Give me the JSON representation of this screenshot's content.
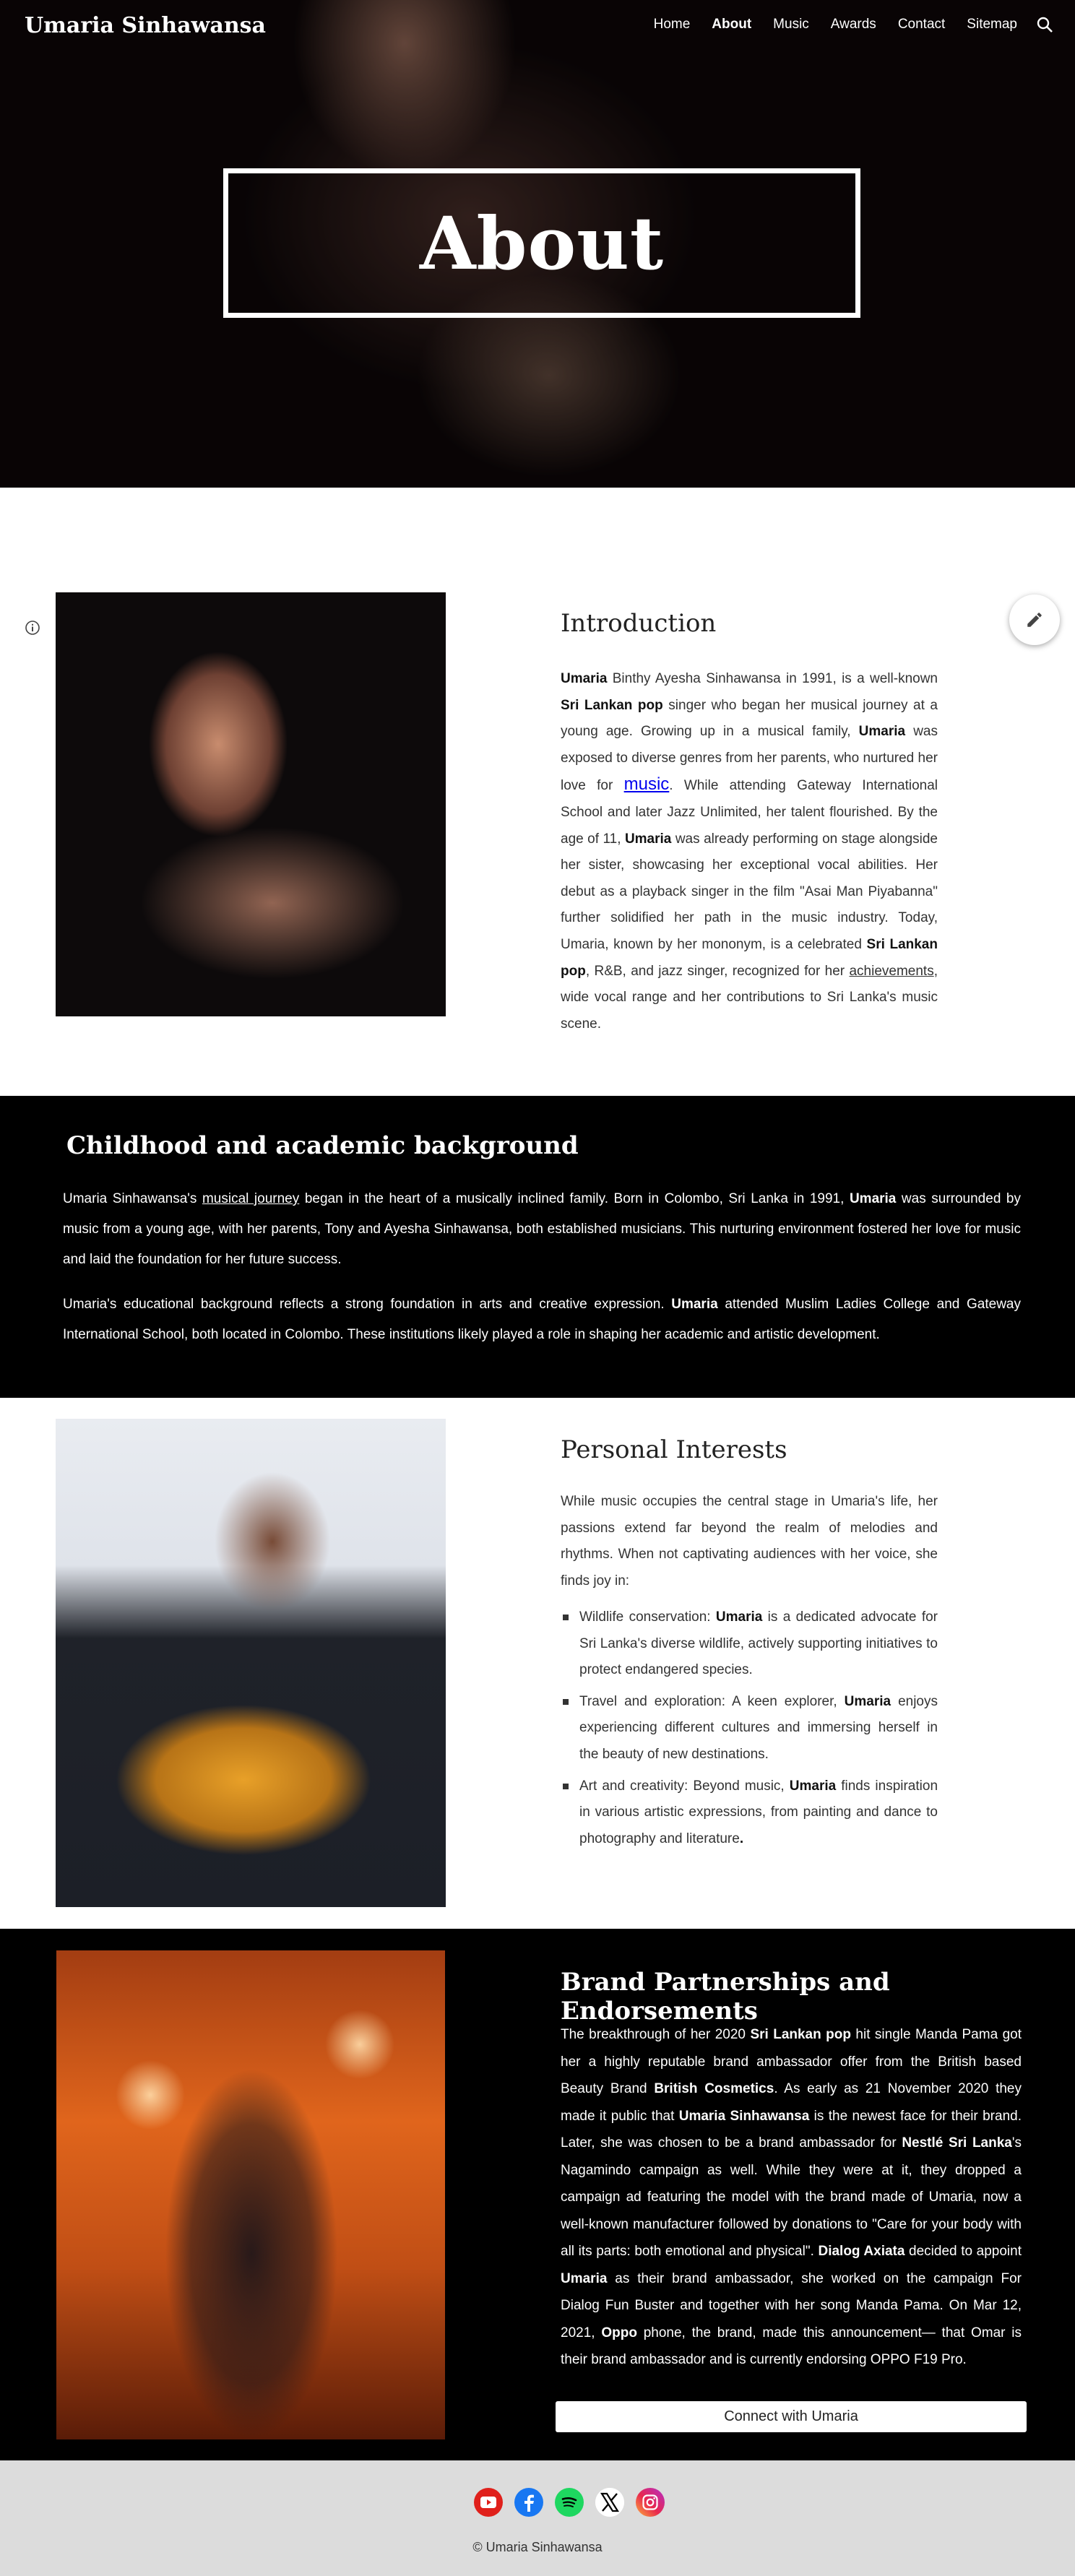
{
  "site": {
    "title": "Umaria Sinhawansa"
  },
  "nav": {
    "items": [
      "Home",
      "About",
      "Music",
      "Awards",
      "Contact",
      "Sitemap"
    ],
    "active": "About"
  },
  "hero": {
    "heading": "About"
  },
  "intro": {
    "heading": "Introduction",
    "p": [
      "Umaria",
      " Binthy Ayesha Sinhawansa in 1991, is a well-known ",
      "Sri Lankan pop",
      " singer who began her musical journey at a young age. Growing up in a musical family, ",
      "Umaria",
      " was exposed to diverse genres from her parents, who nurtured her love for ",
      "music",
      ". While attending Gateway International School and later Jazz Unlimited, her talent flourished. By the age of 11, ",
      "Umaria",
      " was already performing on stage alongside her sister, showcasing her exceptional vocal abilities. Her debut as a playback singer in the film \"Asai Man Piyabanna\" further solidified her path in the music industry. Today, Umaria, known by her mononym, is a celebrated ",
      "Sri Lankan pop",
      ", R&B, and jazz singer, recognized for her ",
      "achievements",
      ", wide vocal range and her contributions to Sri Lanka's music scene."
    ]
  },
  "childhood": {
    "heading": "Childhood and academic background",
    "p1": [
      "Umaria Sinhawansa's ",
      "musical journey",
      " began in the heart of a musically inclined family. Born in Colombo, Sri Lanka in 1991, ",
      "Umaria",
      " was surrounded by music from a young age, with her parents, Tony and Ayesha Sinhawansa, both established musicians. This nurturing environment fostered her love for music and laid the foundation for her future success."
    ],
    "p2": [
      "Umaria's educational background reflects a strong foundation in arts and creative expression. ",
      "Umaria",
      " attended Muslim Ladies College and Gateway International School, both located in Colombo. These institutions likely played a role in shaping her academic and artistic development."
    ]
  },
  "interests": {
    "heading": "Personal Interests",
    "intro": "While music occupies the central stage in Umaria's life, her passions extend far beyond the realm of melodies and rhythms. When not captivating audiences with her voice, she finds joy in:",
    "items": [
      [
        "Wildlife conservation: ",
        "Umaria",
        " is a dedicated advocate for Sri Lanka's diverse wildlife, actively supporting initiatives to protect endangered species."
      ],
      [
        "Travel and exploration: A keen explorer, ",
        "Umaria",
        " enjoys experiencing different cultures and immersing herself in the beauty of new destinations."
      ],
      [
        "Art and creativity: Beyond music, ",
        "Umaria",
        " finds inspiration in various artistic expressions, from painting and dance to photography and literature",
        "."
      ]
    ]
  },
  "brand": {
    "heading": "Brand Partnerships and Endorsements",
    "p": [
      "The breakthrough of her 2020 ",
      "Sri Lankan pop",
      " hit single Manda Pama got her a highly reputable brand ambassador offer from the British based Beauty Brand ",
      "British Cosmetics",
      ". As early as 21 November 2020 they made it public that ",
      "Umaria Sinhawansa",
      " is the newest face for their brand. Later, she was chosen to be a brand ambassador for ",
      "Nestlé Sri Lanka",
      "'s Nagamindo campaign as well. While they were at it, they dropped a campaign ad featuring the model with the brand made of Umaria, now a well-known manufacturer followed by donations to \"Care for your body with all its parts: both emotional and physical\". ",
      "Dialog Axiata",
      " decided to appoint ",
      "Umaria",
      " as their brand ambassador, she worked on the campaign For Dialog Fun Buster and together with her song Manda Pama. On Mar 12, 2021, ",
      "Oppo",
      " phone, the brand, made this announcement— that Omar is their brand ambassador and is currently endorsing OPPO F19 Pro."
    ],
    "button": "Connect with Umaria"
  },
  "footer": {
    "social": [
      "youtube-icon",
      "facebook-icon",
      "spotify-icon",
      "x-icon",
      "instagram-icon"
    ],
    "copyright": "© Umaria Sinhawansa"
  },
  "colors": {
    "youtube": "#e0201b",
    "facebook": "#1877f2",
    "spotify": "#1ed760",
    "x": "#000000",
    "instagram": "#d6249f",
    "dark": "#000000",
    "footer_bg": "#dcdcdc"
  }
}
